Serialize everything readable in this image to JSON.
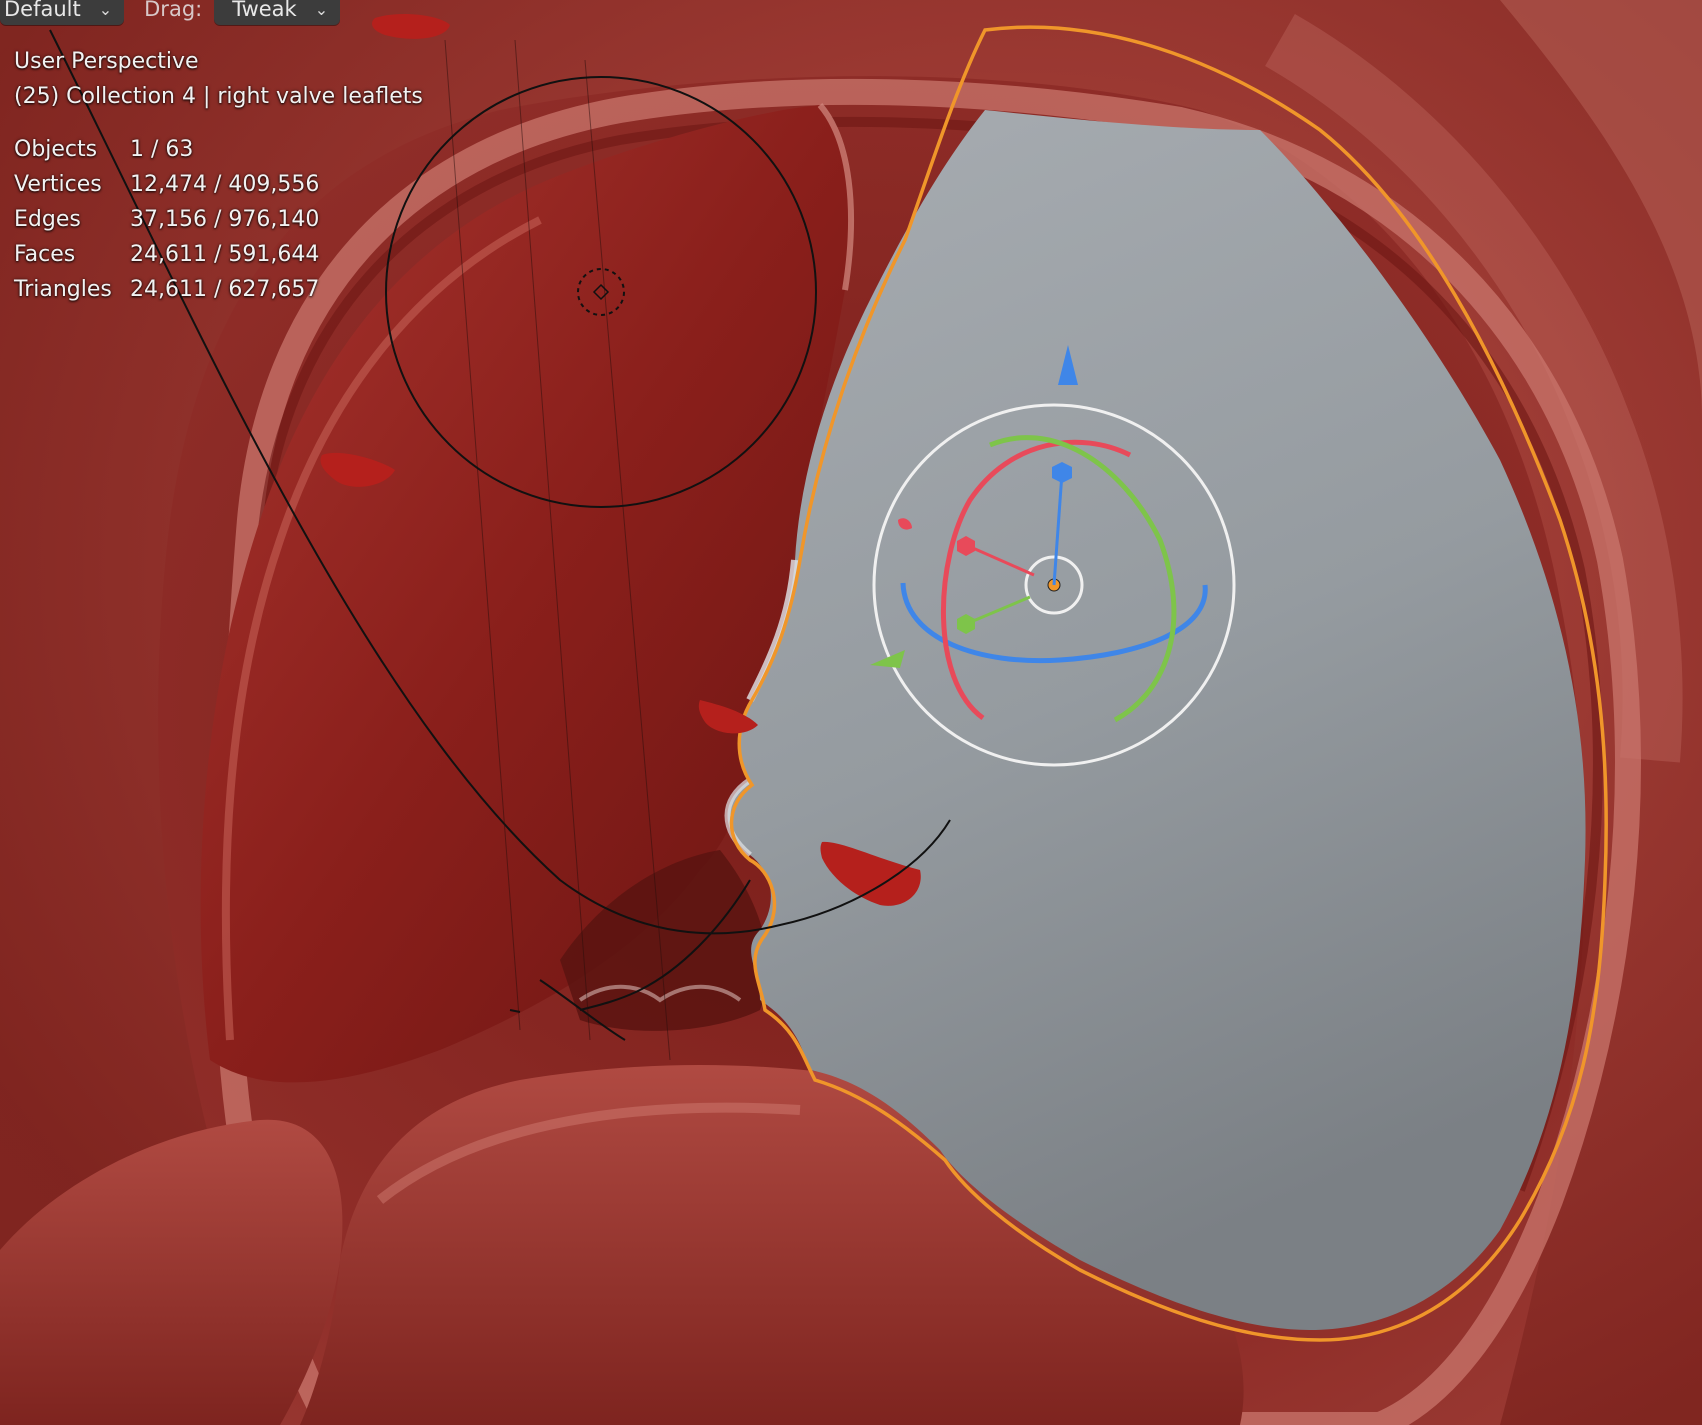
{
  "header": {
    "mode_value": "Default",
    "drag_label": "Drag:",
    "drag_value": "Tweak"
  },
  "overlay": {
    "view_name": "User Perspective",
    "collection_info": "(25) Collection 4 | right valve leaflets"
  },
  "stats": [
    {
      "label": "Objects",
      "value": "1 / 63"
    },
    {
      "label": "Vertices",
      "value": "12,474 / 409,556"
    },
    {
      "label": "Edges",
      "value": "37,156 / 976,140"
    },
    {
      "label": "Faces",
      "value": "24,611 / 591,644"
    },
    {
      "label": "Triangles",
      "value": "24,611 / 627,657"
    }
  ],
  "colors": {
    "selection_outline": "#f0962a",
    "leaflet_gray": "#9aa0a6",
    "tissue_red": "#8e2a25",
    "gizmo_x": "#e84a5a",
    "gizmo_y": "#7ec44a",
    "gizmo_z": "#3f86e8"
  }
}
